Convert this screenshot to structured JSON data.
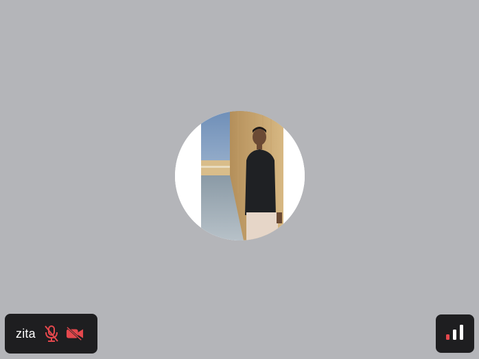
{
  "participant": {
    "name": "zita",
    "mic_icon": "mic-muted-icon",
    "camera_icon": "camera-off-icon"
  },
  "controls": {
    "signal_icon": "signal-strength-icon",
    "signal_level": 0.67
  },
  "colors": {
    "background": "#b4b5b9",
    "pill": "#1e1e20",
    "muted_red": "#e5484d",
    "text": "#ffffff"
  }
}
